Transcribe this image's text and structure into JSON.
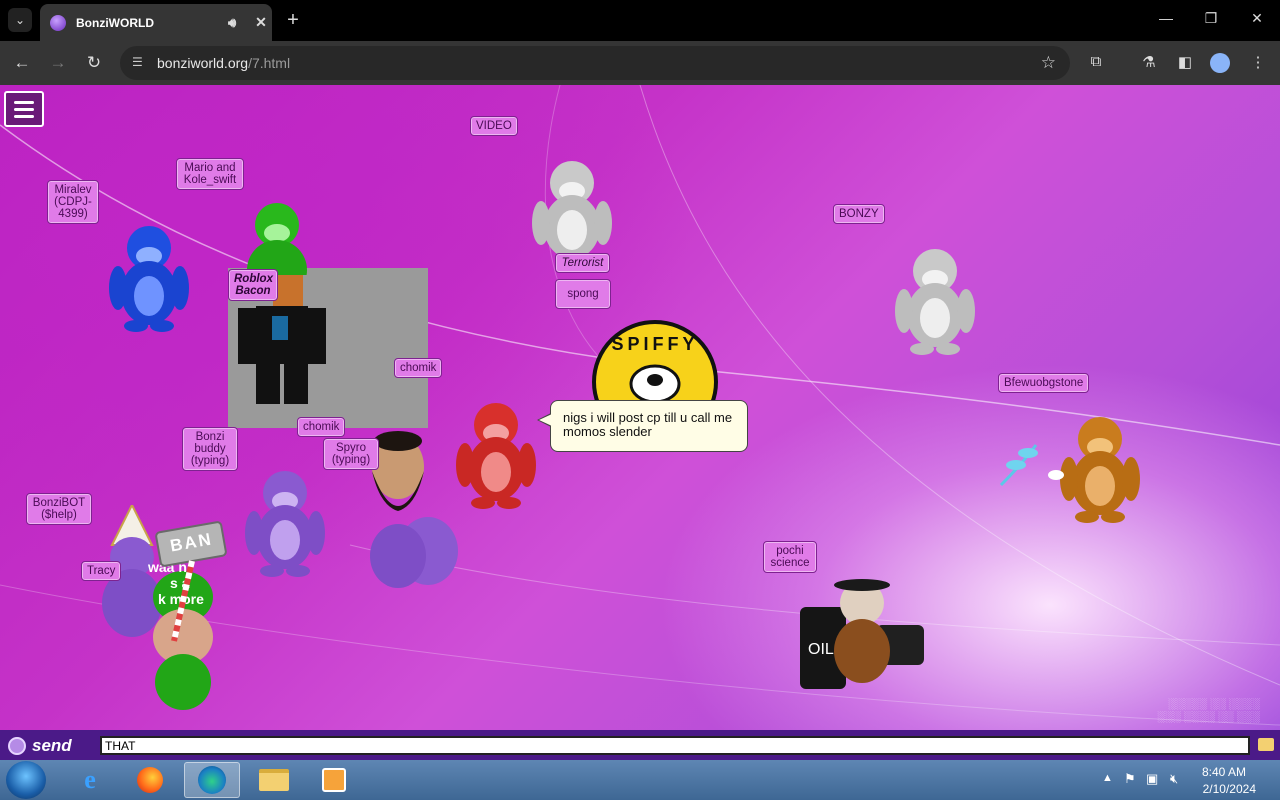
{
  "browser": {
    "tab_title": "BonziWORLD",
    "new_tab_symbol": "+",
    "url_host": "bonziworld.org",
    "url_path": "/7.html"
  },
  "page": {
    "name_tags": [
      {
        "id": "video",
        "text": "VIDEO"
      },
      {
        "id": "mario",
        "text": "Mario and Kole_swift"
      },
      {
        "id": "miralev",
        "text": "Miralev (CDPJ-4399)"
      },
      {
        "id": "roblox",
        "text": "Roblox Bacon"
      },
      {
        "id": "terrorist",
        "text": "Terrorist"
      },
      {
        "id": "spong",
        "text": "spong"
      },
      {
        "id": "bonzy",
        "text": "BONZY"
      },
      {
        "id": "chomik1",
        "text": "chomik"
      },
      {
        "id": "chomik2",
        "text": "chomik"
      },
      {
        "id": "bfewuo",
        "text": "Bfewuobgstone"
      },
      {
        "id": "bonzibuddy",
        "text": "Bonzi buddy (typing)"
      },
      {
        "id": "spyro",
        "text": "Spyro (typing)"
      },
      {
        "id": "bonzibot",
        "text": "BonziBOT ($help)"
      },
      {
        "id": "tracy",
        "text": "Tracy"
      },
      {
        "id": "pochi",
        "text": "pochi science"
      }
    ],
    "speech_bubble": "nigs i will post cp till u call me momos slender",
    "spiffy_logo_text": "SPIFFY",
    "ban_hammer_text": "BAN",
    "partial_text_1": "waa n",
    "partial_text_2": "s a",
    "partial_text_3": "k more",
    "oil_barrel_text": "OIL"
  },
  "chat": {
    "send_label": "send",
    "input_value": "THAT"
  },
  "taskbar": {
    "time": "8:40 AM",
    "date": "2/10/2024"
  },
  "colors": {
    "page_purple": "#c026c6",
    "tag_pink": "#e07be8",
    "chatbar": "#4b1a88"
  }
}
